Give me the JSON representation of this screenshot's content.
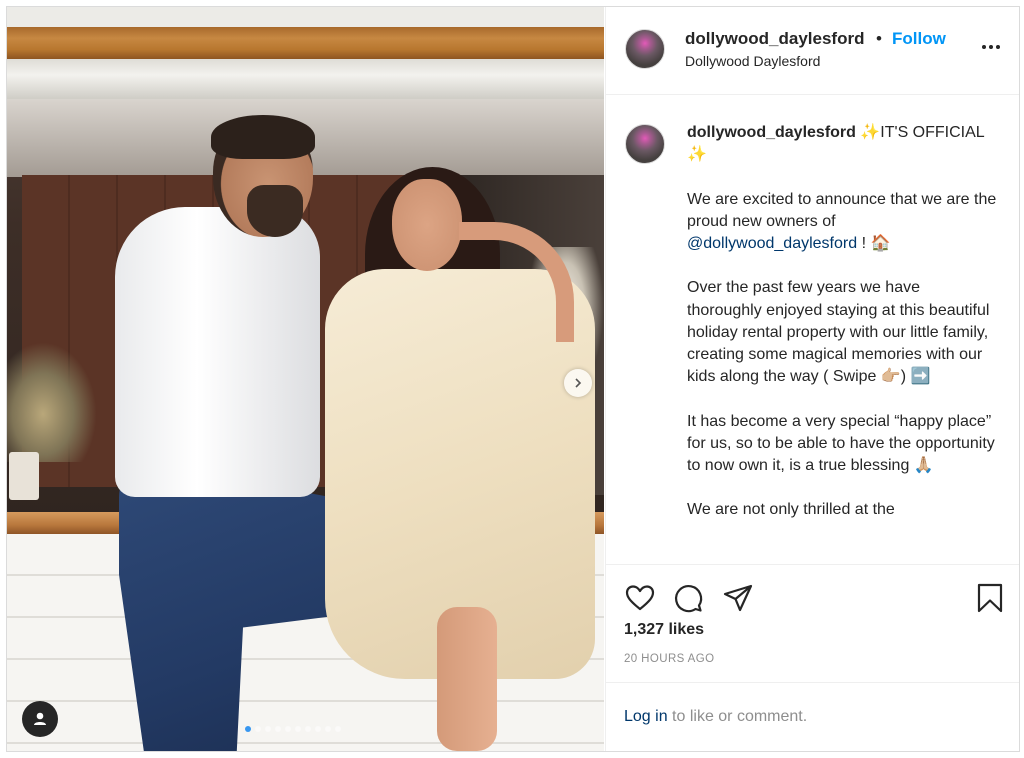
{
  "header": {
    "username": "dollywood_daylesford",
    "separator": "•",
    "follow_label": "Follow",
    "subtitle": "Dollywood Daylesford"
  },
  "caption": {
    "username": "dollywood_daylesford",
    "line1": " ✨IT'S OFFICIAL ✨",
    "p1_text": "We are excited to announce that we are the proud new owners of ",
    "p1_mention": "@dollywood_daylesford",
    "p1_end": " ! 🏠",
    "p2": "Over the past few years we have thoroughly enjoyed staying at this beautiful holiday rental property with our little family, creating some magical memories with our kids along the way ( Swipe 👉🏼) ➡️",
    "p3": "It has become a very special “happy place” for us, so to be able to have the opportunity to now own it, is a true blessing 🙏🏼",
    "p4": "We are not only thrilled at the"
  },
  "actions": {
    "like_icon": "heart-icon",
    "comment_icon": "comment-icon",
    "share_icon": "paper-plane-icon",
    "save_icon": "bookmark-icon"
  },
  "likes_text": "1,327 likes",
  "time_ago": "20 HOURS AGO",
  "login": {
    "link_label": "Log in",
    "rest_text": " to like or comment."
  },
  "carousel": {
    "next_icon": "chevron-right-icon",
    "user_tag_icon": "user-icon",
    "active_slide": 1,
    "slide_count": 10
  },
  "colors": {
    "follow_blue": "#0095f6",
    "mention_blue": "#00376b",
    "muted": "#8e8e8e",
    "text": "#262626"
  }
}
